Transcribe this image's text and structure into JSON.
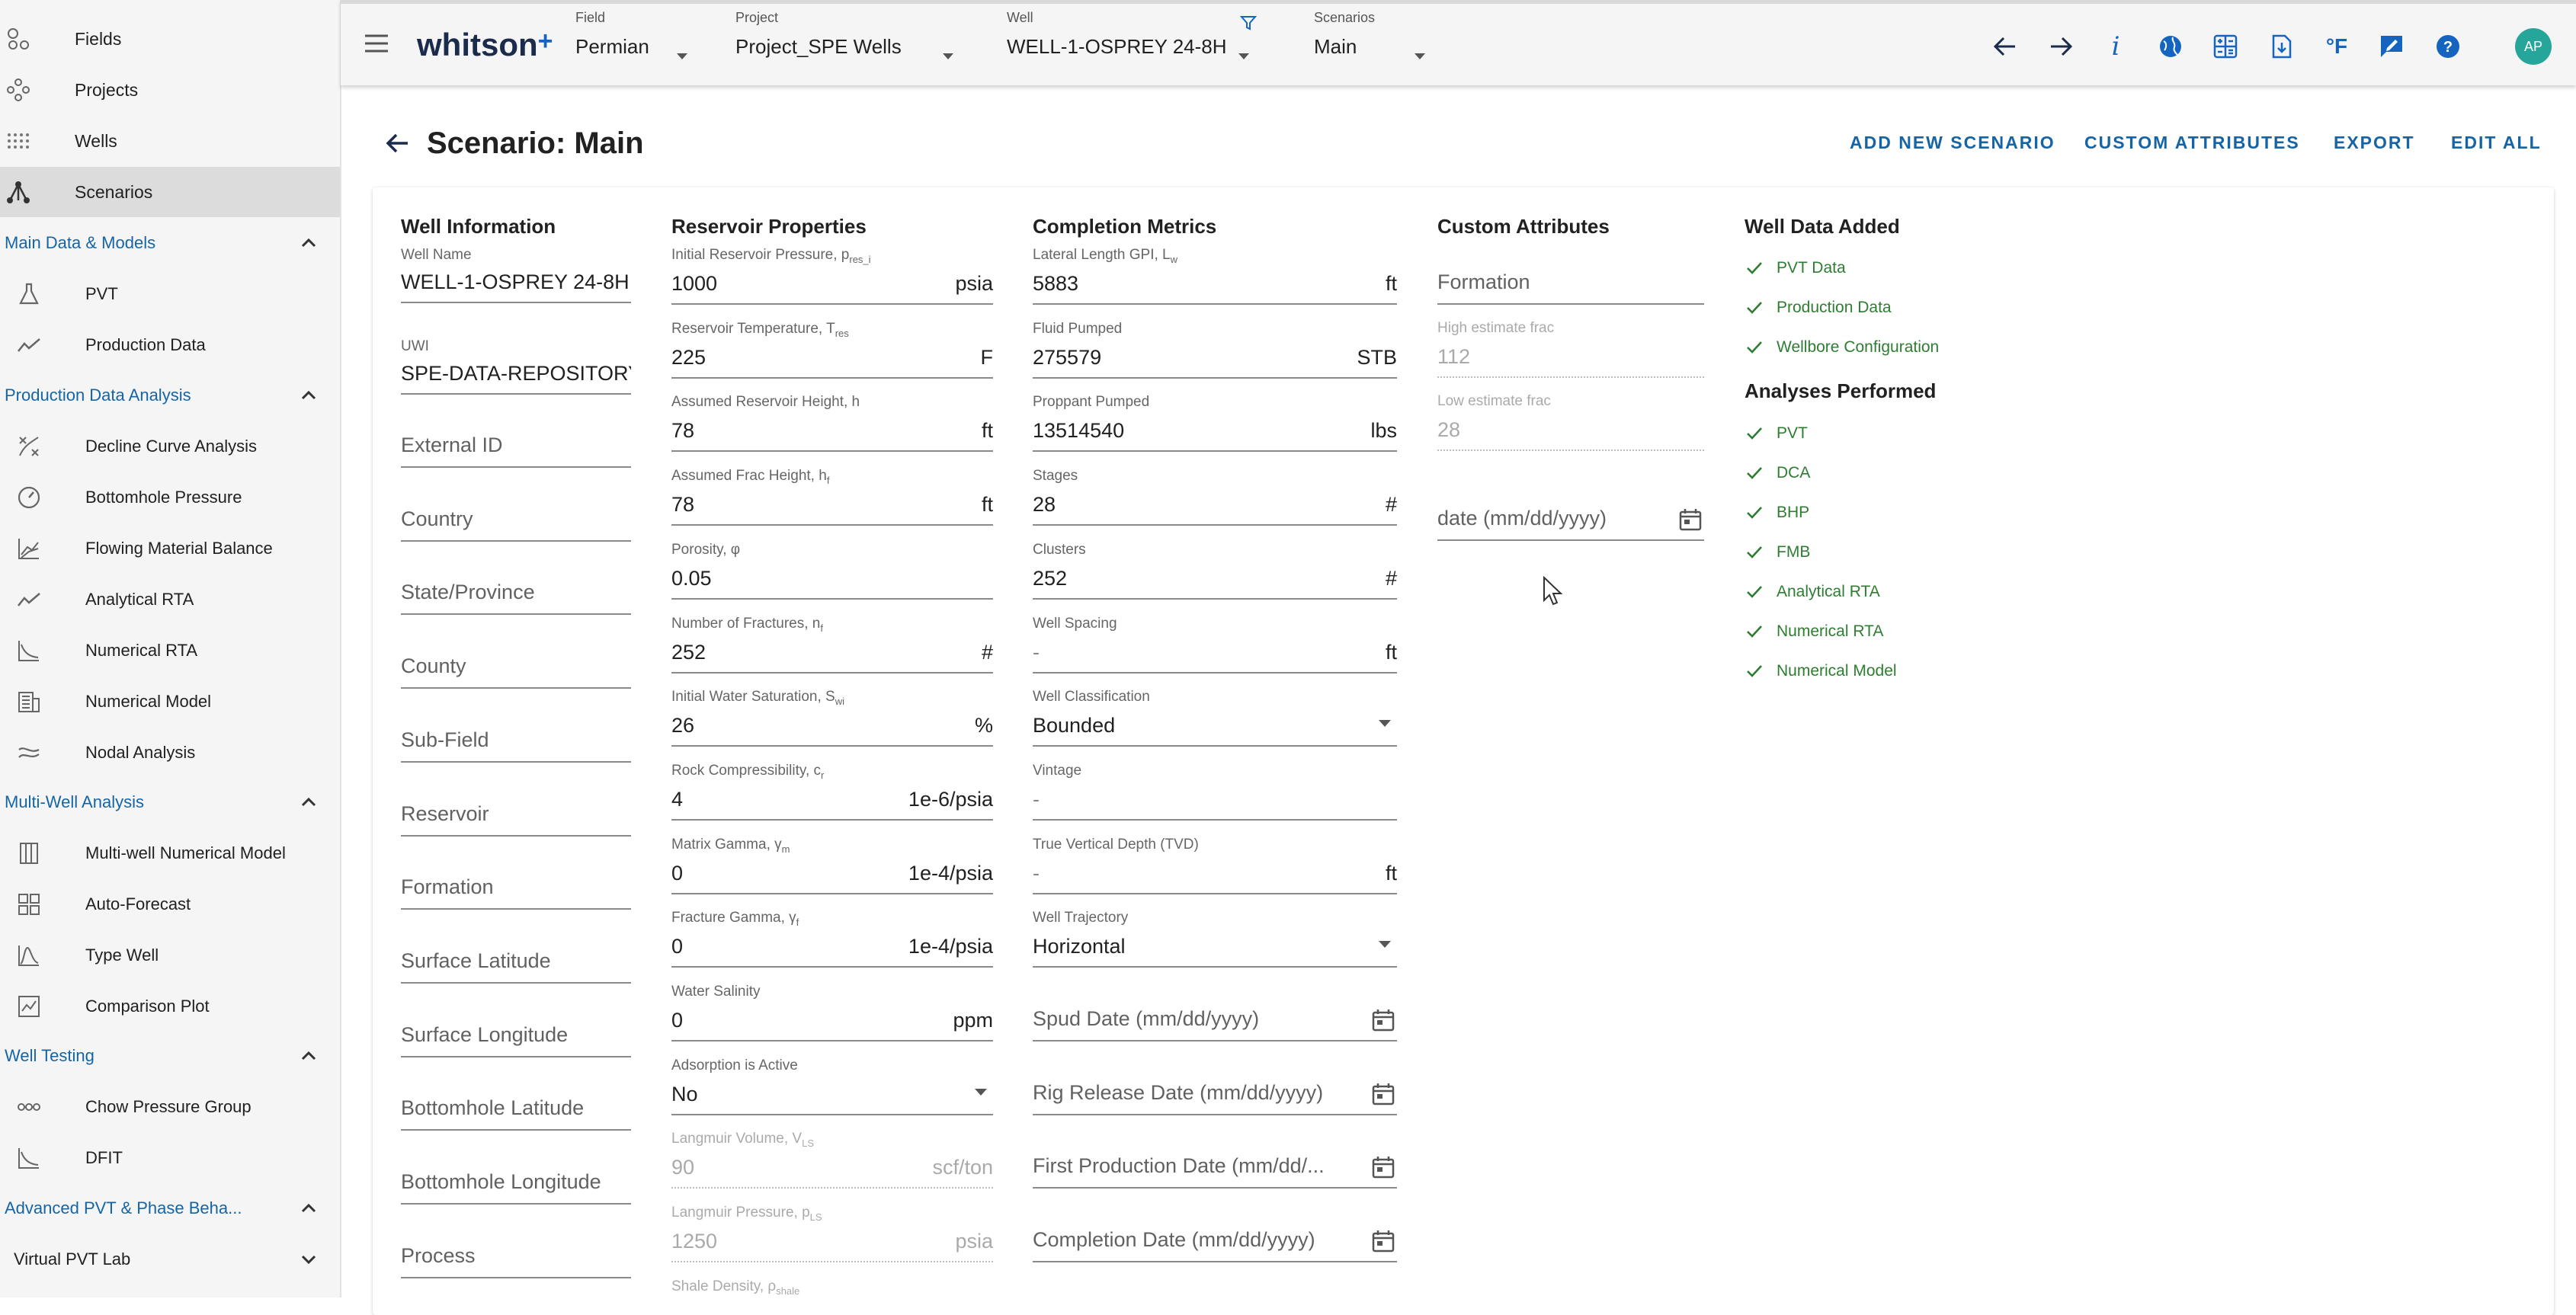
{
  "sidebar": {
    "top_items": [
      {
        "label": "Fields",
        "icon": "fields-icon"
      },
      {
        "label": "Projects",
        "icon": "projects-icon"
      },
      {
        "label": "Wells",
        "icon": "wells-icon"
      },
      {
        "label": "Scenarios",
        "icon": "scenarios-icon"
      }
    ],
    "sections": [
      {
        "label": "Main Data & Models",
        "items": [
          "PVT",
          "Production Data"
        ]
      },
      {
        "label": "Production Data Analysis",
        "items": [
          "Decline Curve Analysis",
          "Bottomhole Pressure",
          "Flowing Material Balance",
          "Analytical RTA",
          "Numerical RTA",
          "Numerical Model",
          "Nodal Analysis"
        ]
      },
      {
        "label": "Multi-Well Analysis",
        "items": [
          "Multi-well Numerical Model",
          "Auto-Forecast",
          "Type Well",
          "Comparison Plot"
        ]
      },
      {
        "label": "Well Testing",
        "items": [
          "Chow Pressure Group",
          "DFIT"
        ]
      },
      {
        "label": "Advanced PVT & Phase Beha...",
        "items": [
          "Virtual PVT Lab"
        ]
      }
    ]
  },
  "topbar": {
    "logo": "whitson",
    "logo_plus": "+",
    "field": {
      "caption": "Field",
      "value": "Permian"
    },
    "project": {
      "caption": "Project",
      "value": "Project_SPE Wells"
    },
    "well": {
      "caption": "Well",
      "value": "WELL-1-OSPREY 24-8H"
    },
    "scenarios": {
      "caption": "Scenarios",
      "value": "Main"
    },
    "temp_unit": "°F",
    "avatar": "AP"
  },
  "page": {
    "title": "Scenario: Main",
    "actions": [
      "ADD NEW SCENARIO",
      "CUSTOM ATTRIBUTES",
      "EXPORT",
      "EDIT ALL"
    ]
  },
  "well_information": {
    "title": "Well Information",
    "well_name": {
      "label": "Well Name",
      "value": "WELL-1-OSPREY 24-8H"
    },
    "uwi": {
      "label": "UWI",
      "value": "SPE-DATA-REPOSITORY-D"
    },
    "placeholders": [
      "External ID",
      "Country",
      "State/Province",
      "County",
      "Sub-Field",
      "Reservoir",
      "Formation",
      "Surface Latitude",
      "Surface Longitude",
      "Bottomhole Latitude",
      "Bottomhole Longitude",
      "Process"
    ]
  },
  "reservoir_properties": {
    "title": "Reservoir Properties",
    "fields": [
      {
        "label": "Initial Reservoir Pressure, p",
        "sub": "res_i",
        "value": "1000",
        "unit": "psia"
      },
      {
        "label": "Reservoir Temperature, T",
        "sub": "res",
        "value": "225",
        "unit": "F"
      },
      {
        "label": "Assumed Reservoir Height, h",
        "sub": "",
        "value": "78",
        "unit": "ft"
      },
      {
        "label": "Assumed Frac Height, h",
        "sub": "f",
        "value": "78",
        "unit": "ft"
      },
      {
        "label": "Porosity, φ",
        "sub": "",
        "value": "0.05",
        "unit": ""
      },
      {
        "label": "Number of Fractures, n",
        "sub": "f",
        "value": "252",
        "unit": "#"
      },
      {
        "label": "Initial Water Saturation, S",
        "sub": "wi",
        "value": "26",
        "unit": "%"
      },
      {
        "label": "Rock Compressibility, c",
        "sub": "r",
        "value": "4",
        "unit": "1e-6/psia"
      },
      {
        "label": "Matrix Gamma, γ",
        "sub": "m",
        "value": "0",
        "unit": "1e-4/psia"
      },
      {
        "label": "Fracture Gamma, γ",
        "sub": "f",
        "value": "0",
        "unit": "1e-4/psia"
      },
      {
        "label": "Water Salinity",
        "sub": "",
        "value": "0",
        "unit": "ppm"
      }
    ],
    "adsorption": {
      "label": "Adsorption is Active",
      "value": "No"
    },
    "disabled_fields": [
      {
        "label": "Langmuir Volume, V",
        "sub": "LS",
        "value": "90",
        "unit": "scf/ton"
      },
      {
        "label": "Langmuir Pressure, p",
        "sub": "LS",
        "value": "1250",
        "unit": "psia"
      }
    ],
    "cut_label": "Shale Density, ρ",
    "cut_sub": "shale"
  },
  "completion_metrics": {
    "title": "Completion Metrics",
    "fields": [
      {
        "label": "Lateral Length GPI, L",
        "sub": "w",
        "value": "5883",
        "unit": "ft"
      },
      {
        "label": "Fluid Pumped",
        "sub": "",
        "value": "275579",
        "unit": "STB"
      },
      {
        "label": "Proppant Pumped",
        "sub": "",
        "value": "13514540",
        "unit": "lbs"
      },
      {
        "label": "Stages",
        "sub": "",
        "value": "28",
        "unit": "#"
      },
      {
        "label": "Clusters",
        "sub": "",
        "value": "252",
        "unit": "#"
      },
      {
        "label": "Well Spacing",
        "sub": "",
        "value": "-",
        "unit": "ft"
      }
    ],
    "well_classification": {
      "label": "Well Classification",
      "value": "Bounded"
    },
    "vintage": {
      "label": "Vintage",
      "value": "-"
    },
    "tvd": {
      "label": "True Vertical Depth (TVD)",
      "value": "-",
      "unit": "ft"
    },
    "well_trajectory": {
      "label": "Well Trajectory",
      "value": "Horizontal"
    },
    "dates": [
      "Spud Date (mm/dd/yyyy)",
      "Rig Release Date (mm/dd/yyyy)",
      "First Production Date (mm/dd/...",
      "Completion Date (mm/dd/yyyy)"
    ]
  },
  "custom_attributes": {
    "title": "Custom Attributes",
    "formation_placeholder": "Formation",
    "high_estimate": {
      "label": "High estimate frac",
      "value": "112"
    },
    "low_estimate": {
      "label": "Low estimate frac",
      "value": "28"
    },
    "date_placeholder": "date (mm/dd/yyyy)"
  },
  "well_data_added": {
    "title": "Well Data Added",
    "items": [
      "PVT Data",
      "Production Data",
      "Wellbore Configuration"
    ]
  },
  "analyses_performed": {
    "title": "Analyses Performed",
    "items": [
      "PVT",
      "DCA",
      "BHP",
      "FMB",
      "Analytical RTA",
      "Numerical RTA",
      "Numerical Model"
    ]
  },
  "colors": {
    "accent": "#1565a6",
    "success": "#2e7d32",
    "avatar": "#26a69a"
  }
}
